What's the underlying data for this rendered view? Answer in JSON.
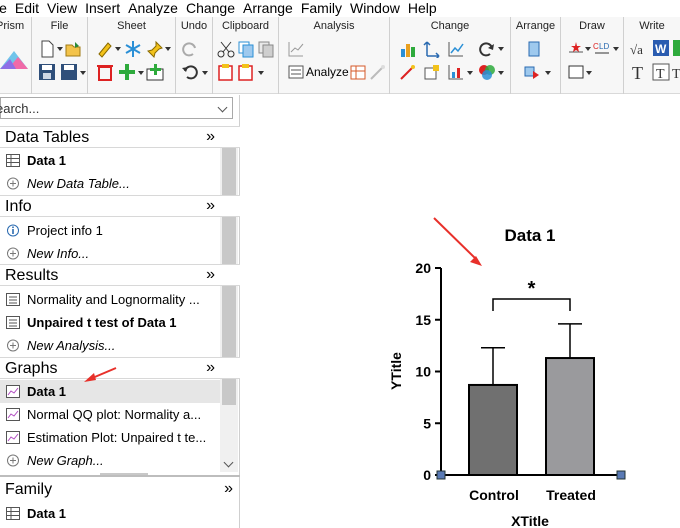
{
  "menu": [
    "le",
    "Edit",
    "View",
    "Insert",
    "Analyze",
    "Change",
    "Arrange",
    "Family",
    "Window",
    "Help"
  ],
  "ribbon": {
    "groups": [
      "Prism",
      "File",
      "Sheet",
      "Undo",
      "Clipboard",
      "Analysis",
      "Change",
      "Arrange",
      "Draw",
      "Write"
    ],
    "analyze_label": "Analyze"
  },
  "navigator": {
    "search_placeholder": "earch...",
    "sections": [
      {
        "title": "Data Tables",
        "items": [
          "Data 1",
          "New Data Table..."
        ]
      },
      {
        "title": "Info",
        "items": [
          "Project info 1",
          "New Info..."
        ]
      },
      {
        "title": "Results",
        "items": [
          "Normality and Lognormality ...",
          "Unpaired t test of Data 1",
          "New Analysis..."
        ]
      },
      {
        "title": "Graphs",
        "items": [
          "Data 1",
          "Normal QQ plot: Normality a...",
          "Estimation Plot: Unpaired t te...",
          "New Graph..."
        ]
      },
      {
        "title": "Family",
        "items": [
          "Data 1"
        ]
      }
    ],
    "chevron": "»"
  },
  "chart_data": {
    "type": "bar",
    "title": "Data 1",
    "xlabel": "XTitle",
    "ylabel": "YTitle",
    "categories": [
      "Control",
      "Treated"
    ],
    "values": [
      8.7,
      11.3
    ],
    "error_upper": [
      12.3,
      14.6
    ],
    "ylim": [
      0,
      20
    ],
    "yticks": [
      "0",
      "5",
      "10",
      "15",
      "20"
    ],
    "significance": "*",
    "colors": {
      "Control": "#707070",
      "Treated": "#9a9a9d",
      "handles": "#5a7ab5"
    }
  },
  "colors": {
    "annotation_arrow": "#e8302a"
  }
}
